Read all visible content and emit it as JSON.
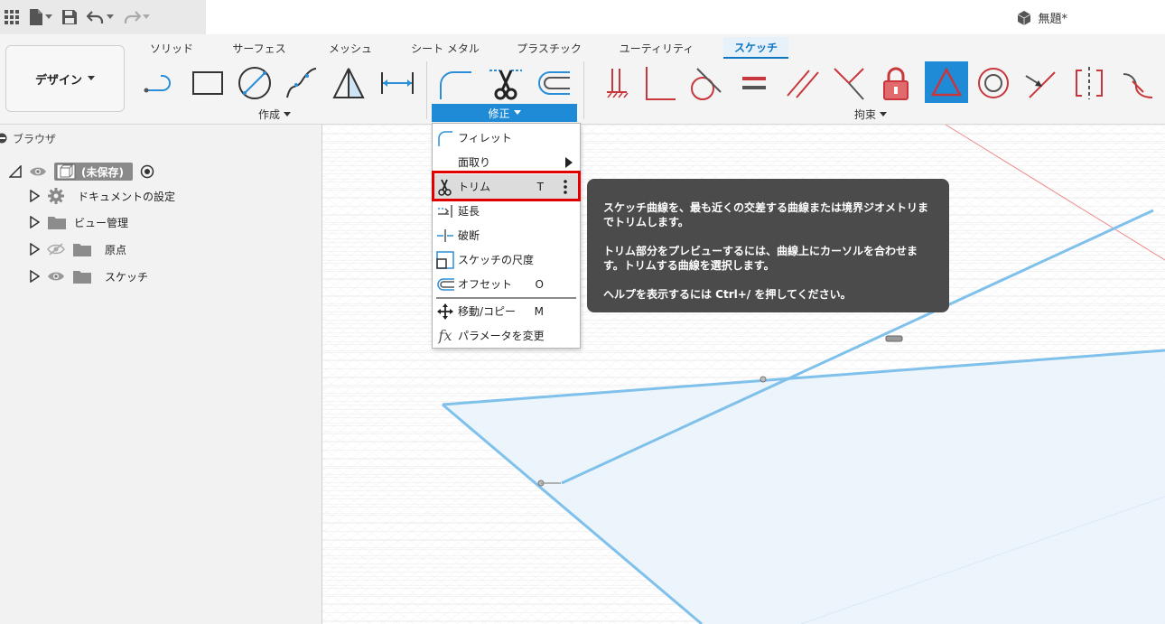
{
  "topbar": {
    "document_title": "無題*"
  },
  "ribbon": {
    "workspace_label": "デザイン",
    "tabs": [
      "ソリッド",
      "サーフェス",
      "メッシュ",
      "シート メタル",
      "プラスチック",
      "ユーティリティ",
      "スケッチ"
    ],
    "groups": {
      "create": "作成",
      "modify": "修正",
      "constraints": "拘束"
    }
  },
  "browser": {
    "title": "ブラウザ",
    "root_label": "(未保存)",
    "items": [
      "ドキュメントの設定",
      "ビュー管理",
      "原点",
      "スケッチ"
    ]
  },
  "menu": {
    "items": [
      {
        "label": "フィレット",
        "key": ""
      },
      {
        "label": "面取り",
        "key": ""
      },
      {
        "label": "トリム",
        "key": "T"
      },
      {
        "label": "延長",
        "key": ""
      },
      {
        "label": "破断",
        "key": ""
      },
      {
        "label": "スケッチの尺度",
        "key": ""
      },
      {
        "label": "オフセット",
        "key": "O"
      },
      {
        "label": "移動/コピー",
        "key": "M"
      },
      {
        "label": "パラメータを変更",
        "key": ""
      }
    ]
  },
  "tooltip": {
    "line1": "スケッチ曲線を、最も近くの交差する曲線または境界ジオメトリまでトリムします。",
    "line2": "トリム部分をプレビューするには、曲線上にカーソルを合わせます。トリムする曲線を選択します。",
    "line3": "ヘルプを表示するには Ctrl+/ を押してください。"
  },
  "colors": {
    "accent": "#1f8ad6",
    "tab_active": "#0f76c1",
    "highlight_box": "#e00000",
    "sketch_line": "#6fb8e6",
    "constraint_red": "#c8373b"
  }
}
